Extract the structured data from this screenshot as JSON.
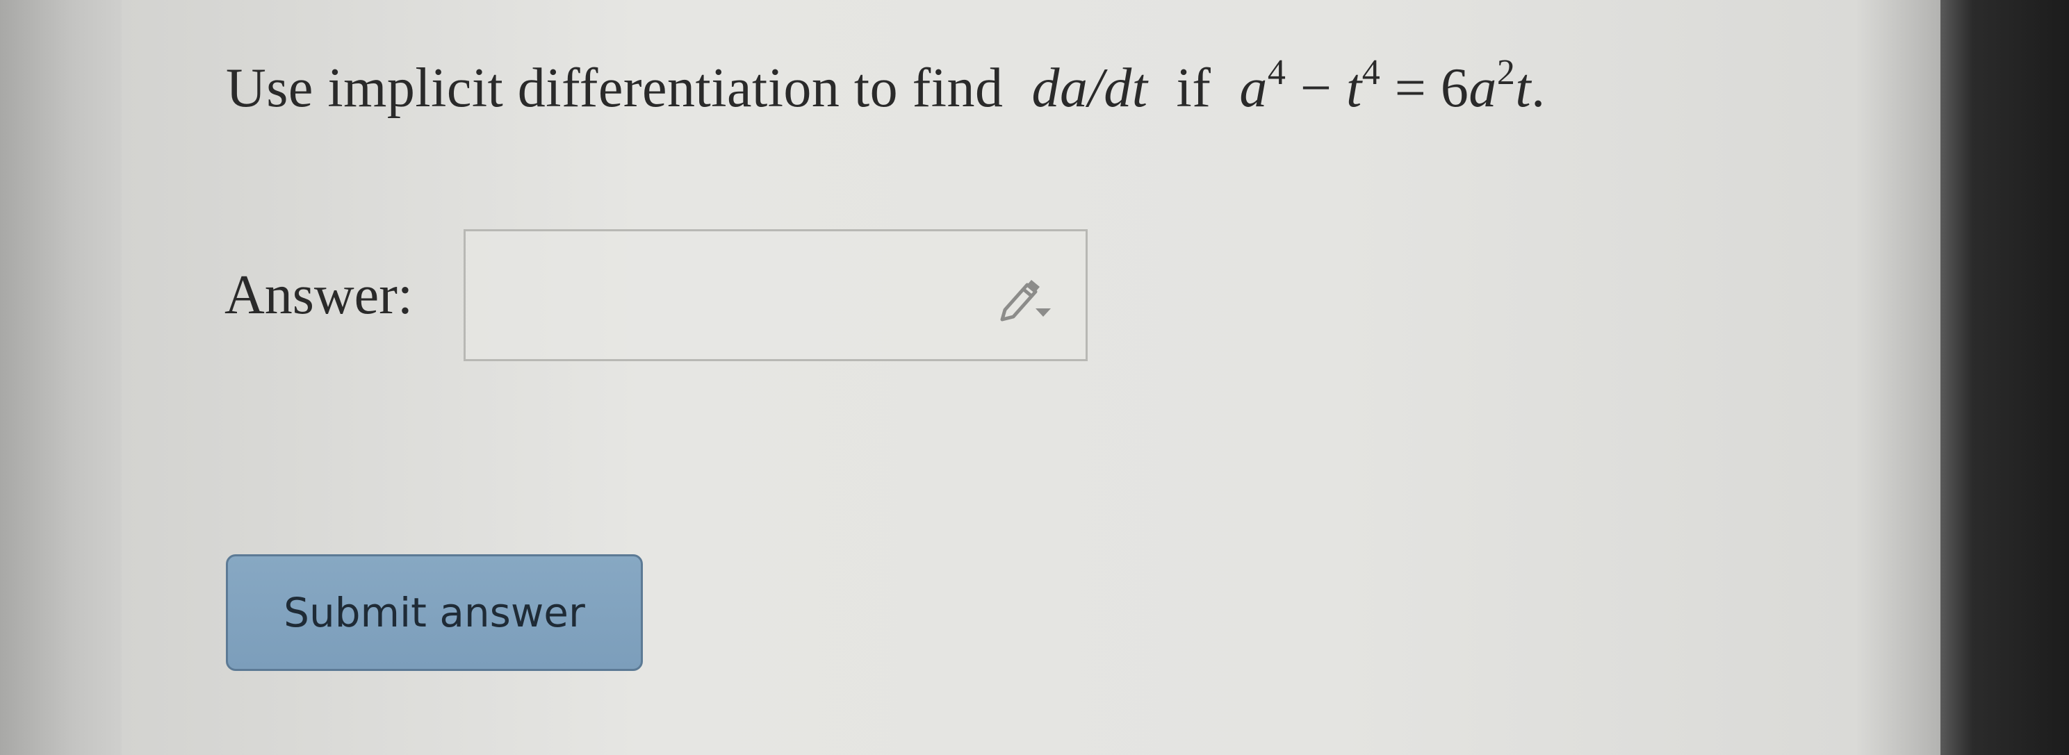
{
  "question": {
    "text_prefix": "Use implicit differentiation to find",
    "derivative": "da/dt",
    "connector": "if",
    "equation": {
      "a": "a",
      "a_exp": "4",
      "minus": "−",
      "t": "t",
      "t_exp": "4",
      "equals": "=",
      "rhs_coef": "6",
      "rhs_a": "a",
      "rhs_a_exp": "2",
      "rhs_t": "t",
      "end": "."
    }
  },
  "answer": {
    "label": "Answer:",
    "value": "",
    "placeholder": ""
  },
  "submit": {
    "label": "Submit answer"
  },
  "icons": {
    "editor": "pencil-dropdown-icon"
  }
}
